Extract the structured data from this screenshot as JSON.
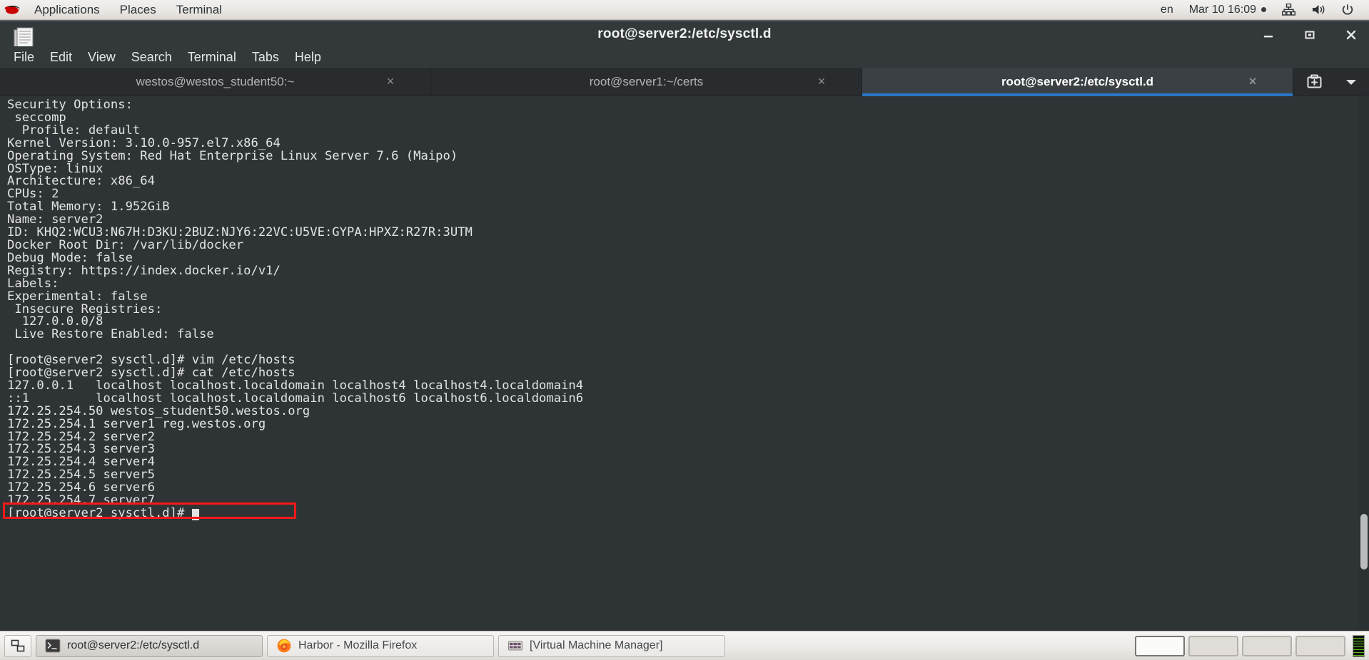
{
  "top_panel": {
    "logo_icon": "redhat-logo-icon",
    "menus": [
      "Applications",
      "Places",
      "Terminal"
    ],
    "right": {
      "language": "en",
      "datetime": "Mar 10 16:09",
      "recording_dot": "recording-indicator-icon",
      "network_icon": "network-icon",
      "volume_icon": "volume-icon",
      "power_icon": "power-icon"
    }
  },
  "window": {
    "icon": "document-icon",
    "title": "root@server2:/etc/sysctl.d",
    "controls": {
      "minimize": "minimize-icon",
      "maximize": "maximize-icon",
      "close": "close-icon"
    },
    "menubar": [
      "File",
      "Edit",
      "View",
      "Search",
      "Terminal",
      "Tabs",
      "Help"
    ],
    "tabs": [
      {
        "label": "westos@westos_student50:~",
        "active": false,
        "close": "×"
      },
      {
        "label": "root@server1:~/certs",
        "active": false,
        "close": "×"
      },
      {
        "label": "root@server2:/etc/sysctl.d",
        "active": true,
        "close": "×"
      }
    ],
    "tab_actions": {
      "new_tab_icon": "new-tab-icon",
      "tab_menu_icon": "chevron-down-icon"
    }
  },
  "terminal": {
    "accent_color": "#2a76c6",
    "background_color": "#2e3436",
    "foreground_color": "#e3e3e3",
    "highlight_color": "#f71818",
    "highlighted_line": "172.25.254.1 server1 reg.westos.org",
    "content": "Security Options:\n seccomp\n  Profile: default\nKernel Version: 3.10.0-957.el7.x86_64\nOperating System: Red Hat Enterprise Linux Server 7.6 (Maipo)\nOSType: linux\nArchitecture: x86_64\nCPUs: 2\nTotal Memory: 1.952GiB\nName: server2\nID: KHQ2:WCU3:N67H:D3KU:2BUZ:NJY6:22VC:U5VE:GYPA:HPXZ:R27R:3UTM\nDocker Root Dir: /var/lib/docker\nDebug Mode: false\nRegistry: https://index.docker.io/v1/\nLabels:\nExperimental: false\n Insecure Registries:\n  127.0.0.0/8\n Live Restore Enabled: false\n\n[root@server2 sysctl.d]# vim /etc/hosts\n[root@server2 sysctl.d]# cat /etc/hosts\n127.0.0.1   localhost localhost.localdomain localhost4 localhost4.localdomain4\n::1         localhost localhost.localdomain localhost6 localhost6.localdomain6\n172.25.254.50 westos_student50.westos.org\n172.25.254.1 server1 reg.westos.org\n172.25.254.2 server2\n172.25.254.3 server3\n172.25.254.4 server4\n172.25.254.5 server5\n172.25.254.6 server6\n172.25.254.7 server7\n[root@server2 sysctl.d]# "
  },
  "taskbar": {
    "show_desktop_icon": "show-desktop-icon",
    "tasks": [
      {
        "label": "root@server2:/etc/sysctl.d",
        "icon": "terminal-icon",
        "active": true
      },
      {
        "label": "Harbor - Mozilla Firefox",
        "icon": "firefox-icon",
        "active": false
      },
      {
        "label": "[Virtual Machine Manager]",
        "icon": "vmm-icon",
        "active": false
      }
    ],
    "workspaces": [
      {
        "name": "workspace-1",
        "active": true
      },
      {
        "name": "workspace-2",
        "active": false
      },
      {
        "name": "workspace-3",
        "active": false
      },
      {
        "name": "workspace-4",
        "active": false
      }
    ],
    "system_monitor_icon": "system-monitor-icon"
  }
}
